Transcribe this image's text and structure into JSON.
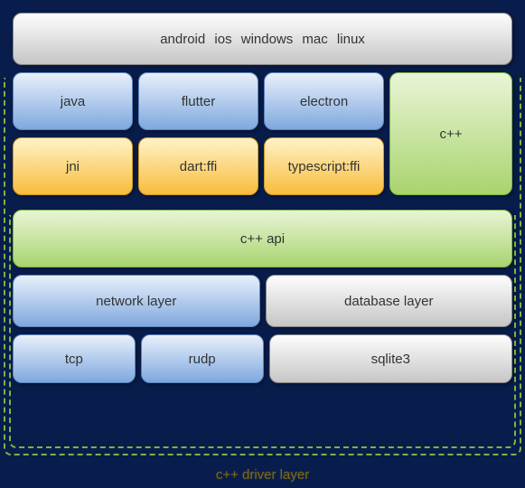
{
  "platforms": "android  ios  windows mac linux",
  "langs": {
    "java": "java",
    "flutter": "flutter",
    "electron": "electron"
  },
  "ffis": {
    "jni": "jni",
    "dart": "dart:ffi",
    "ts": "typescript:ffi"
  },
  "cpp_side": "c++",
  "api": "c++ api",
  "mid": {
    "network": "network layer",
    "database": "database layer"
  },
  "bottom": {
    "tcp": "tcp",
    "rudp": "rudp",
    "sqlite": "sqlite3"
  },
  "bracket_label": "c++ driver layer"
}
